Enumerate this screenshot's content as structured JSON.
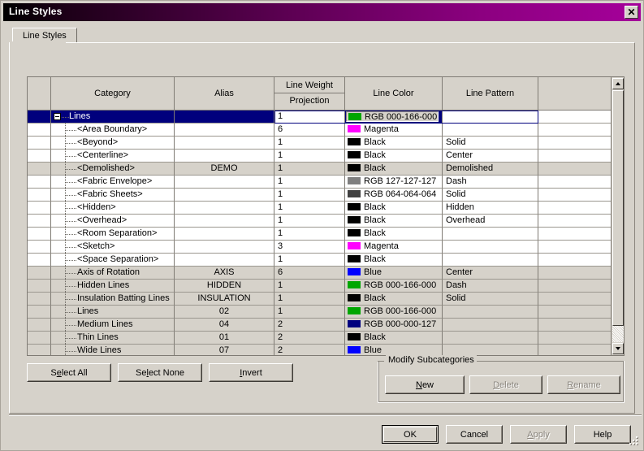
{
  "window": {
    "title": "Line Styles",
    "close_label": "✕"
  },
  "tabs": [
    {
      "label": "Line Styles",
      "selected": true
    }
  ],
  "grid": {
    "headers": {
      "category": "Category",
      "alias": "Alias",
      "line_weight": "Line Weight",
      "projection": "Projection",
      "line_color": "Line Color",
      "line_pattern": "Line Pattern",
      "extra": ""
    },
    "rows": [
      {
        "category": "Lines",
        "level": "root",
        "expander": "minus",
        "alias": "",
        "weight": "1",
        "color_name": "RGB 000-166-000",
        "color_hex": "#00a600",
        "pattern": "",
        "selected": true,
        "shaded": false
      },
      {
        "category": "<Area Boundary>",
        "level": "child",
        "alias": "",
        "weight": "6",
        "color_name": "Magenta",
        "color_hex": "#ff00ff",
        "pattern": "",
        "selected": false,
        "shaded": false
      },
      {
        "category": "<Beyond>",
        "level": "child",
        "alias": "",
        "weight": "1",
        "color_name": "Black",
        "color_hex": "#000000",
        "pattern": "Solid",
        "selected": false,
        "shaded": false
      },
      {
        "category": "<Centerline>",
        "level": "child",
        "alias": "",
        "weight": "1",
        "color_name": "Black",
        "color_hex": "#000000",
        "pattern": "Center",
        "selected": false,
        "shaded": false
      },
      {
        "category": "<Demolished>",
        "level": "child",
        "alias": "DEMO",
        "weight": "1",
        "color_name": "Black",
        "color_hex": "#000000",
        "pattern": "Demolished",
        "selected": false,
        "shaded": true
      },
      {
        "category": "<Fabric Envelope>",
        "level": "child",
        "alias": "",
        "weight": "1",
        "color_name": "RGB 127-127-127",
        "color_hex": "#7f7f7f",
        "pattern": "Dash",
        "selected": false,
        "shaded": false
      },
      {
        "category": "<Fabric Sheets>",
        "level": "child",
        "alias": "",
        "weight": "1",
        "color_name": "RGB 064-064-064",
        "color_hex": "#404040",
        "pattern": "Solid",
        "selected": false,
        "shaded": false
      },
      {
        "category": "<Hidden>",
        "level": "child",
        "alias": "",
        "weight": "1",
        "color_name": "Black",
        "color_hex": "#000000",
        "pattern": "Hidden",
        "selected": false,
        "shaded": false
      },
      {
        "category": "<Overhead>",
        "level": "child",
        "alias": "",
        "weight": "1",
        "color_name": "Black",
        "color_hex": "#000000",
        "pattern": "Overhead",
        "selected": false,
        "shaded": false
      },
      {
        "category": "<Room Separation>",
        "level": "child",
        "alias": "",
        "weight": "1",
        "color_name": "Black",
        "color_hex": "#000000",
        "pattern": "",
        "selected": false,
        "shaded": false
      },
      {
        "category": "<Sketch>",
        "level": "child",
        "alias": "",
        "weight": "3",
        "color_name": "Magenta",
        "color_hex": "#ff00ff",
        "pattern": "",
        "selected": false,
        "shaded": false
      },
      {
        "category": "<Space Separation>",
        "level": "child",
        "alias": "",
        "weight": "1",
        "color_name": "Black",
        "color_hex": "#000000",
        "pattern": "",
        "selected": false,
        "shaded": false
      },
      {
        "category": "Axis of Rotation",
        "level": "child",
        "alias": "AXIS",
        "weight": "6",
        "color_name": "Blue",
        "color_hex": "#0000ff",
        "pattern": "Center",
        "selected": false,
        "shaded": true
      },
      {
        "category": "Hidden Lines",
        "level": "child",
        "alias": "HIDDEN",
        "weight": "1",
        "color_name": "RGB 000-166-000",
        "color_hex": "#00a600",
        "pattern": "Dash",
        "selected": false,
        "shaded": true
      },
      {
        "category": "Insulation Batting Lines",
        "level": "child",
        "alias": "INSULATION",
        "weight": "1",
        "color_name": "Black",
        "color_hex": "#000000",
        "pattern": "Solid",
        "selected": false,
        "shaded": true
      },
      {
        "category": "Lines",
        "level": "child",
        "alias": "02",
        "weight": "1",
        "color_name": "RGB 000-166-000",
        "color_hex": "#00a600",
        "pattern": "",
        "selected": false,
        "shaded": true
      },
      {
        "category": "Medium Lines",
        "level": "child",
        "alias": "04",
        "weight": "2",
        "color_name": "RGB 000-000-127",
        "color_hex": "#00007f",
        "pattern": "",
        "selected": false,
        "shaded": true
      },
      {
        "category": "Thin Lines",
        "level": "child",
        "alias": "01",
        "weight": "2",
        "color_name": "Black",
        "color_hex": "#000000",
        "pattern": "",
        "selected": false,
        "shaded": true
      },
      {
        "category": "Wide Lines",
        "level": "child",
        "alias": "07",
        "weight": "2",
        "color_name": "Blue",
        "color_hex": "#0000ff",
        "pattern": "",
        "selected": false,
        "shaded": true
      }
    ]
  },
  "selection_buttons": {
    "select_all": {
      "pre": "S",
      "mn": "e",
      "post": "lect All"
    },
    "select_none": {
      "pre": "Se",
      "mn": "l",
      "post": "ect None"
    },
    "invert": {
      "pre": "",
      "mn": "I",
      "post": "nvert"
    }
  },
  "modify_group": {
    "title": "Modify Subcategories",
    "new": {
      "pre": "",
      "mn": "N",
      "post": "ew",
      "enabled": true
    },
    "delete": {
      "pre": "",
      "mn": "D",
      "post": "elete",
      "enabled": false
    },
    "rename": {
      "pre": "",
      "mn": "R",
      "post": "ename",
      "enabled": false
    }
  },
  "footer_buttons": {
    "ok": {
      "label": "OK",
      "enabled": true,
      "default": true
    },
    "cancel": {
      "label": "Cancel",
      "enabled": true
    },
    "apply": {
      "pre": "",
      "mn": "A",
      "post": "pply",
      "enabled": false
    },
    "help": {
      "label": "Help",
      "enabled": true
    }
  },
  "scrollbar": {
    "up_arrow": "▲",
    "down_arrow": "▼"
  },
  "colors": {
    "dialog_face": "#d6d2ca",
    "selection": "#00007d",
    "shaded_row": "#d6d2ca",
    "titlebar_start": "#000000",
    "titlebar_end": "#a5009a"
  }
}
